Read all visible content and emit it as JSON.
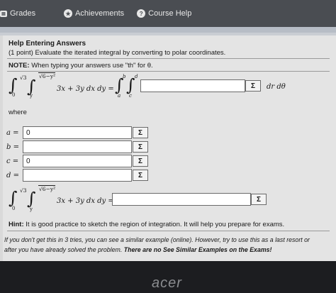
{
  "navbar": {
    "items": [
      {
        "label": "Grades",
        "icon": "grades-icon"
      },
      {
        "label": "Achievements",
        "icon": "star-icon"
      },
      {
        "label": "Course Help",
        "icon": "question-icon"
      }
    ]
  },
  "problem": {
    "help_link": "Help Entering Answers",
    "statement": "(1 point) Evaluate the iterated integral by converting to polar coordinates.",
    "note_label": "NOTE:",
    "note_text": "When typing your answers use \"th\" for θ."
  },
  "integral1": {
    "outer_upper": "√3",
    "outer_lower": "0",
    "inner_upper": "√6−y²",
    "inner_lower": "y",
    "integrand": "3x + 3y dx dy =",
    "polar_outer_upper": "b",
    "polar_outer_lower": "a",
    "polar_inner_upper": "d",
    "polar_inner_lower": "c",
    "answer_value": "",
    "suffix": "dr dθ",
    "sigma": "Σ"
  },
  "where_label": "where",
  "bounds": [
    {
      "label": "a =",
      "value": "0"
    },
    {
      "label": "b =",
      "value": ""
    },
    {
      "label": "c =",
      "value": "0"
    },
    {
      "label": "d =",
      "value": ""
    }
  ],
  "integral2": {
    "outer_upper": "√3",
    "outer_lower": "0",
    "inner_upper": "√6−y²",
    "inner_lower": "y",
    "integrand": "3x + 3y dx dy =",
    "answer_value": "",
    "sigma": "Σ"
  },
  "hint": {
    "label": "Hint:",
    "text": "It is good practice to sketch the region of integration. It will help you prepare for exams."
  },
  "footer": {
    "line1": "If you don't get this in 3 tries, you can see a similar example (online). However, try to use this as a last resort or",
    "line2_plain": "after you have already solved the problem.",
    "line2_bold": "There are no See Similar Examples on the Exams!"
  },
  "bezel": {
    "brand": "acer"
  }
}
